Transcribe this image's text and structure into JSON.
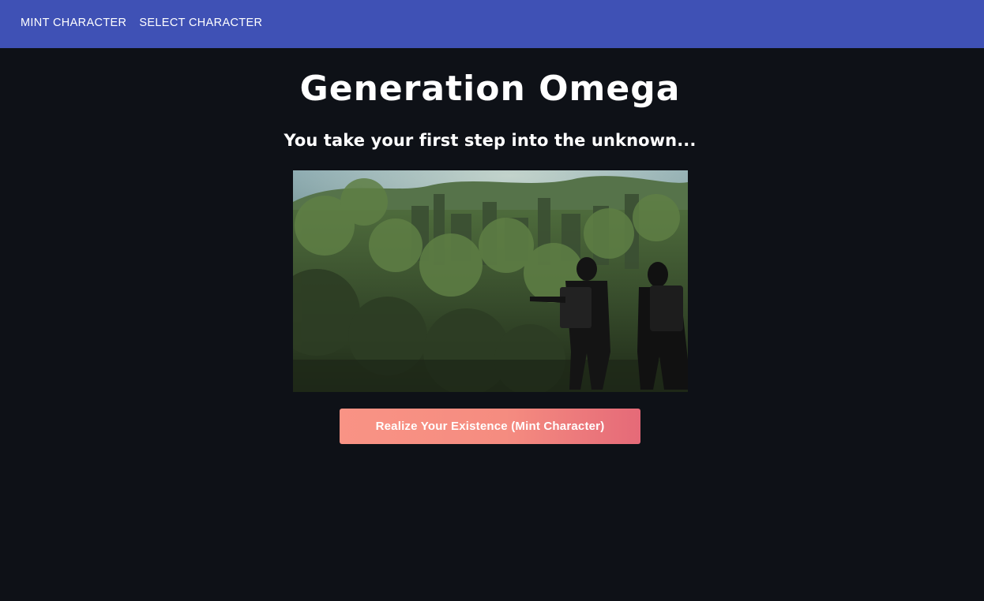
{
  "nav": {
    "items": [
      {
        "label": "MINT CHARACTER"
      },
      {
        "label": "SELECT CHARACTER"
      }
    ]
  },
  "main": {
    "title": "Generation Omega",
    "subtitle": "You take your first step into the unknown...",
    "hero_image": "overgrown-ruins-explorers-illustration",
    "mint_button_label": "Realize Your Existence (Mint Character)"
  },
  "colors": {
    "navbar": "#3f51b5",
    "background": "#0e1117",
    "button_gradient_start": "#f99385",
    "button_gradient_end": "#e56a78"
  }
}
